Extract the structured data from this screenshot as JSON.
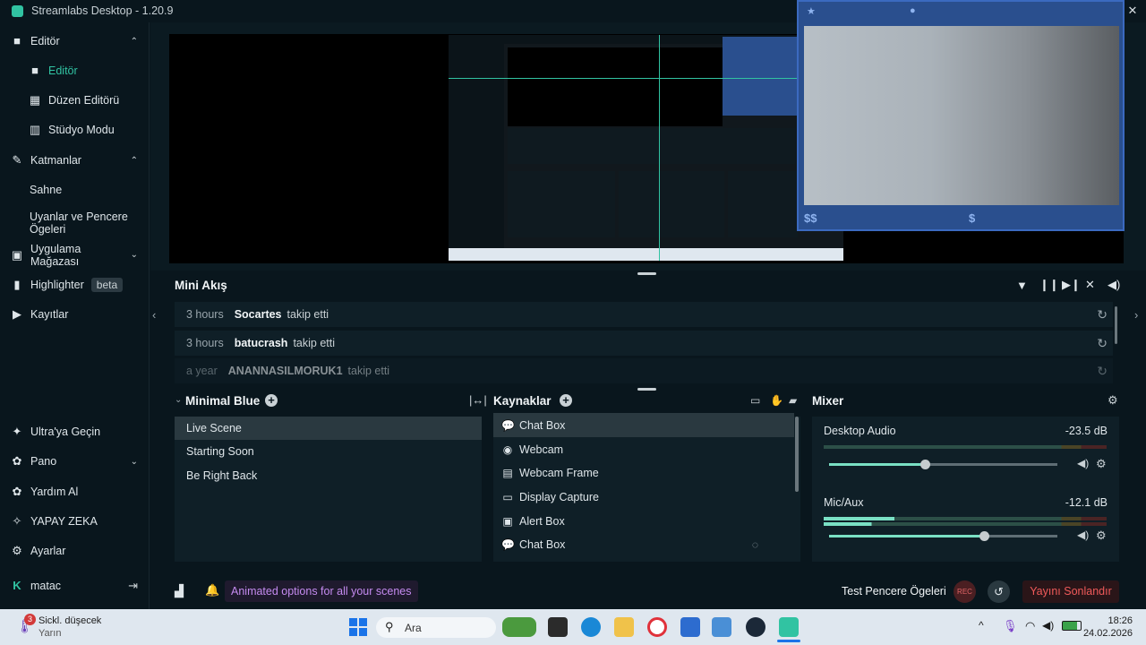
{
  "window": {
    "title": "Streamlabs Desktop - 1.20.9",
    "minimize": "—",
    "maximize": "☐",
    "close": "✕"
  },
  "sidebar": {
    "editor_group": "Editör",
    "editor": "Editör",
    "layout_editor": "Düzen Editörü",
    "studio_mode": "Stüdyo Modu",
    "layers_group": "Katmanlar",
    "scene": "Sahne",
    "widgets": "Uyanlar ve Pencere Ögeleri",
    "app_store": "Uygulama Mağazası",
    "highlighter": "Highlighter",
    "highlighter_badge": "beta",
    "recordings": "Kayıtlar",
    "ultra": "Ultra'ya Geçin",
    "dashboard": "Pano",
    "help": "Yardım Al",
    "ai": "YAPAY ZEKA",
    "settings": "Ayarlar",
    "user": "matac"
  },
  "webcam": {
    "label_left": "$$",
    "label_right": "$"
  },
  "minifeed": {
    "title": "Mini Akış",
    "rows": [
      {
        "time": "3 hours",
        "user": "Socartes",
        "action": "takip etti"
      },
      {
        "time": "3 hours",
        "user": "batucrash",
        "action": "takip etti"
      },
      {
        "time": "a year",
        "user": "ANANNASILMORUK1",
        "action": "takip etti"
      }
    ]
  },
  "scenes": {
    "title": "Minimal Blue",
    "items": [
      "Live Scene",
      "Starting Soon",
      "Be Right Back"
    ]
  },
  "sources": {
    "title": "Kaynaklar",
    "items": [
      "Chat Box",
      "Webcam",
      "Webcam Frame",
      "Display Capture",
      "Alert Box",
      "Chat Box"
    ]
  },
  "mixer": {
    "title": "Mixer",
    "channels": [
      {
        "name": "Desktop Audio",
        "db": "-23.5 dB",
        "level": 0.42
      },
      {
        "name": "Mic/Aux",
        "db": "-12.1 dB",
        "level": 0.68
      }
    ]
  },
  "footer": {
    "tip": "Animated options for all your scenes",
    "test_widgets": "Test Pencere Ögeleri",
    "rec": "REC",
    "end_stream": "Yayını Sonlandır"
  },
  "taskbar": {
    "weather_title": "Sickl. düşecek",
    "weather_sub": "Yarın",
    "weather_badge": "3",
    "search": "Ara",
    "time": "18:26",
    "date": "24.02.2026"
  },
  "colors": {
    "accent": "#31c3a2",
    "danger": "#f05a5a",
    "purple": "#c58bf0"
  }
}
